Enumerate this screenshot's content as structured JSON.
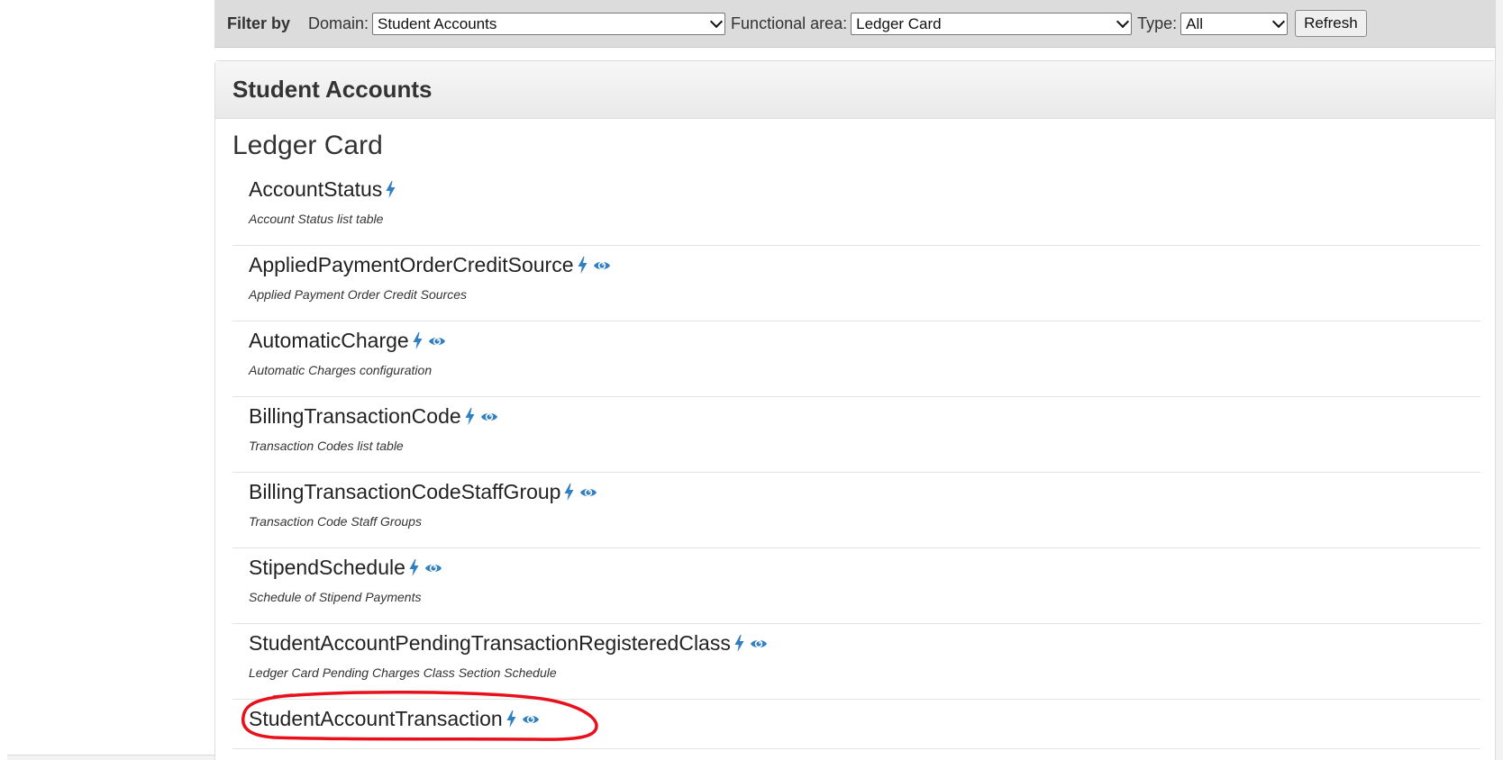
{
  "filter": {
    "title": "Filter by",
    "domain_label": "Domain:",
    "domain_value": "Student Accounts",
    "area_label": "Functional area:",
    "area_value": "Ledger Card",
    "type_label": "Type:",
    "type_value": "All",
    "refresh_label": "Refresh"
  },
  "panel": {
    "title": "Student Accounts",
    "section": "Ledger Card"
  },
  "items": [
    {
      "name": "AccountStatus",
      "desc": "Account Status list table",
      "icons": [
        "bolt-icon"
      ]
    },
    {
      "name": "AppliedPaymentOrderCreditSource",
      "desc": "Applied Payment Order Credit Sources",
      "icons": [
        "bolt-icon",
        "eye-icon"
      ]
    },
    {
      "name": "AutomaticCharge",
      "desc": "Automatic Charges configuration",
      "icons": [
        "bolt-icon",
        "eye-icon"
      ]
    },
    {
      "name": "BillingTransactionCode",
      "desc": "Transaction Codes list table",
      "icons": [
        "bolt-icon",
        "eye-icon"
      ]
    },
    {
      "name": "BillingTransactionCodeStaffGroup",
      "desc": "Transaction Code Staff Groups",
      "icons": [
        "bolt-icon",
        "eye-icon"
      ]
    },
    {
      "name": "StipendSchedule",
      "desc": "Schedule of Stipend Payments",
      "icons": [
        "bolt-icon",
        "eye-icon"
      ]
    },
    {
      "name": "StudentAccountPendingTransactionRegisteredClass",
      "desc": "Ledger Card Pending Charges Class Section Schedule",
      "icons": [
        "bolt-icon",
        "eye-icon"
      ]
    },
    {
      "name": "StudentAccountTransaction",
      "desc": "",
      "icons": [
        "bolt-icon",
        "eye-icon"
      ]
    }
  ],
  "colors": {
    "icon_blue": "#2f7fc1",
    "highlight_red": "#e8101a"
  }
}
